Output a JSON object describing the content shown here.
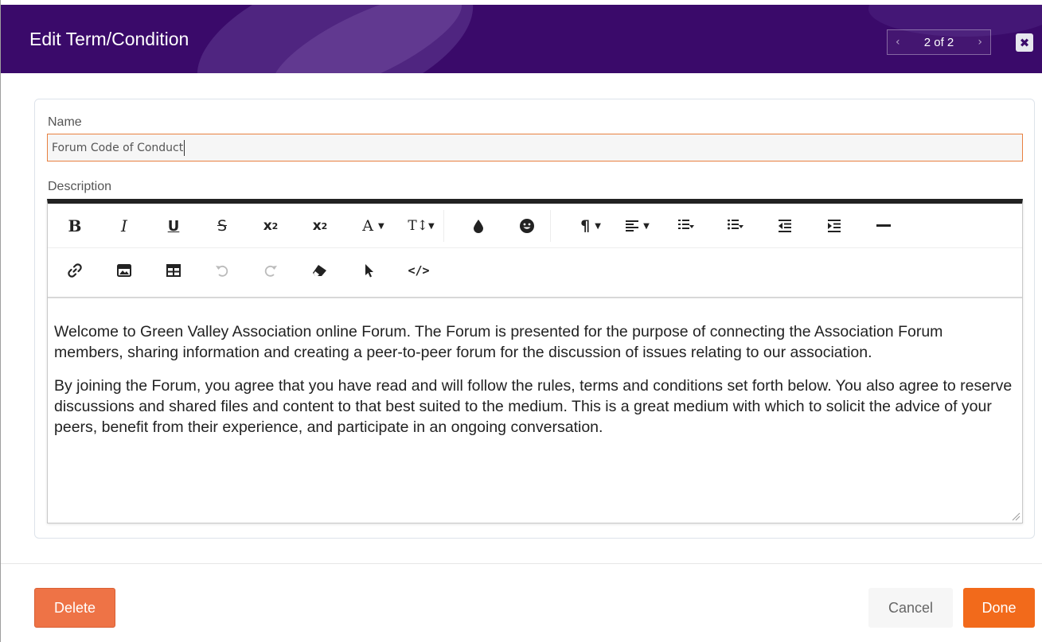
{
  "header": {
    "title": "Edit Term/Condition",
    "pager": {
      "prev": "‹",
      "count": "2 of 2",
      "next": "›"
    },
    "close": "✖"
  },
  "form": {
    "name_label": "Name",
    "name_value": "Forum Code of Conduct",
    "description_label": "Description"
  },
  "editor": {
    "toolbar_row1": [
      {
        "name": "bold-icon",
        "glyph": "B"
      },
      {
        "name": "italic-icon",
        "glyph": "I"
      },
      {
        "name": "underline-icon",
        "glyph": "U"
      },
      {
        "name": "strikethrough-icon",
        "glyph": "S"
      },
      {
        "name": "subscript-icon",
        "glyph": "x₂"
      },
      {
        "name": "superscript-icon",
        "glyph": "x²"
      },
      {
        "name": "font-family-icon",
        "glyph": "A ▾"
      },
      {
        "name": "font-size-icon",
        "glyph": "T↕▾"
      },
      {
        "name": "color-drop-icon",
        "glyph": "💧"
      },
      {
        "name": "emoji-icon",
        "glyph": "☻"
      },
      {
        "name": "paragraph-format-icon",
        "glyph": "¶ ▾"
      },
      {
        "name": "align-icon",
        "glyph": "≡ ▾"
      },
      {
        "name": "ordered-list-icon",
        "glyph": "⋮≡"
      },
      {
        "name": "unordered-list-icon",
        "glyph": "⋮≡"
      },
      {
        "name": "outdent-icon",
        "glyph": "⇤"
      },
      {
        "name": "indent-icon",
        "glyph": "⇥"
      },
      {
        "name": "horizontal-line-icon",
        "glyph": "—"
      }
    ],
    "toolbar_row2": [
      {
        "name": "link-icon",
        "glyph": "🔗"
      },
      {
        "name": "image-icon",
        "glyph": "▣"
      },
      {
        "name": "table-icon",
        "glyph": "⊞"
      },
      {
        "name": "undo-icon",
        "glyph": "↶"
      },
      {
        "name": "redo-icon",
        "glyph": "↷"
      },
      {
        "name": "clear-formatting-icon",
        "glyph": "⌫"
      },
      {
        "name": "select-all-icon",
        "glyph": "➤"
      },
      {
        "name": "code-view-icon",
        "glyph": "</>"
      }
    ],
    "paragraphs": [
      "Welcome to Green Valley Association online Forum. The Forum  is presented for the purpose of connecting the Association Forum members, sharing information and creating a peer-to-peer forum for the discussion of issues relating to our association.",
      "By joining the Forum,  you agree that you have read and will follow the rules, terms and conditions set forth below.  You also agree to reserve discussions and shared files and content to that best suited to the medium. This is a great medium with which to solicit the advice of your peers, benefit from their experience, and participate in an ongoing conversation."
    ]
  },
  "footer": {
    "delete_label": "Delete",
    "cancel_label": "Cancel",
    "done_label": "Done"
  },
  "colors": {
    "header_bg": "#3a0a6a",
    "accent_orange": "#f26a1b",
    "delete_orange": "#ee7346",
    "input_border": "#e88040"
  }
}
